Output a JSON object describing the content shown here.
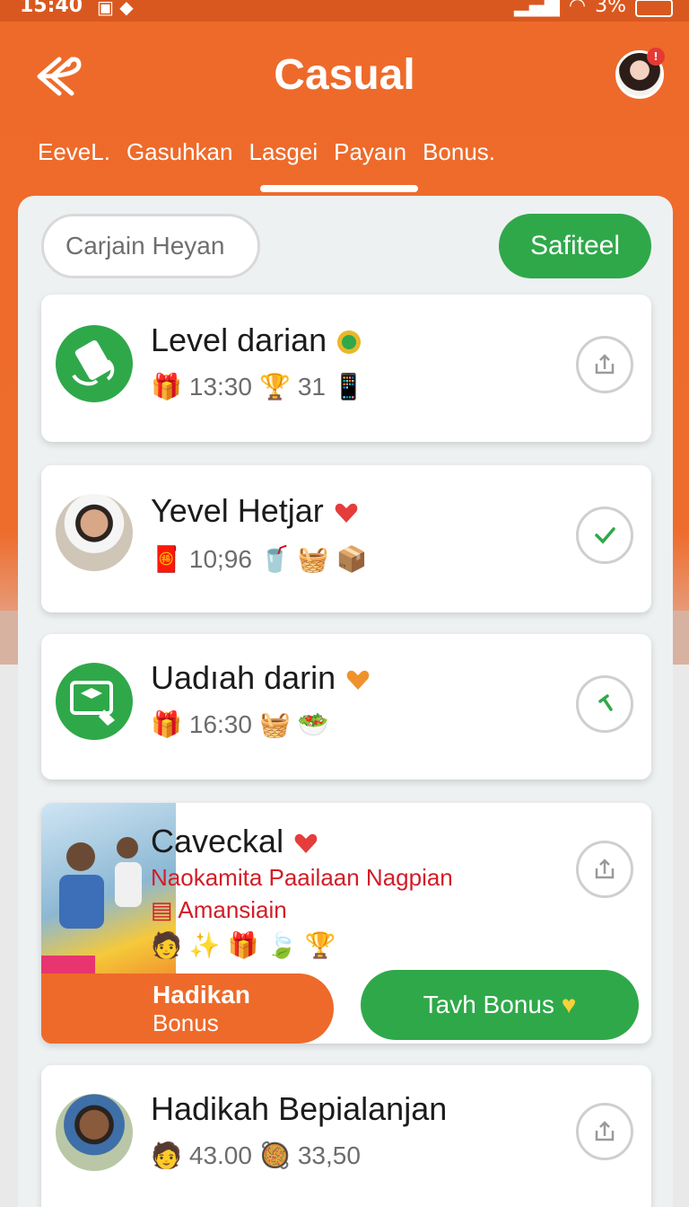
{
  "status": {
    "time": "15:40",
    "battery": "3%"
  },
  "header": {
    "title": "Casual"
  },
  "tabs": [
    {
      "label": "EeveL."
    },
    {
      "label": "Gasuhkan"
    },
    {
      "label": "Lasgei"
    },
    {
      "label": "Payaın"
    },
    {
      "label": "Bonus."
    }
  ],
  "search": {
    "placeholder": "Carjain Heyan"
  },
  "filter_button": {
    "label": "Safiteel"
  },
  "cards": [
    {
      "name": "Level darian",
      "stat1": "13:30",
      "stat2": "31",
      "action": "share-icon"
    },
    {
      "name": "Yevel Hetjar",
      "stat1": "10;96",
      "action": "check-icon"
    },
    {
      "name": "Uadıah darin",
      "stat1": "16:30",
      "action": "hammer-icon"
    },
    {
      "name": "Caveckal",
      "subtitle1": "Naokamita Paailaan Nagpian",
      "subtitle2": "Amansiain",
      "tag_title": "Hadikan",
      "tag_sub": "Bonus",
      "button": "Tavh Bonus",
      "action": "share-icon"
    },
    {
      "name": "Hadikah Bepialanjan",
      "stat1": "43.00",
      "stat2": "33,50",
      "action": "share-icon"
    }
  ],
  "colors": {
    "primary": "#ee6a2a",
    "accent": "#2fa84a"
  }
}
